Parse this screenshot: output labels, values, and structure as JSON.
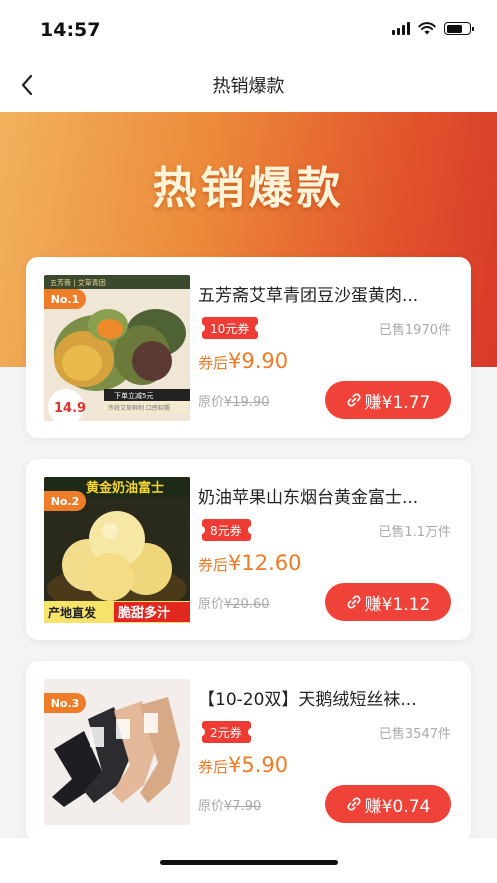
{
  "status_bar": {
    "time": "14:57"
  },
  "nav": {
    "title": "热销爆款"
  },
  "banner": {
    "title": "热销爆款"
  },
  "products": [
    {
      "rank": "No.1",
      "title": "五芳斋艾草青团豆沙蛋黄肉...",
      "coupon": "10元券",
      "sold": "已售1970件",
      "after_label": "券后",
      "after_price": "¥9.90",
      "orig_label": "原价",
      "orig_price": "¥19.90",
      "earn": "赚¥1.77",
      "thumb": {
        "top_text": "五芳斋 | 艾草青团",
        "price_badge": "14.9",
        "banner_text": "下单立减5元",
        "bottom_text": "传统艾草鲜制 口感软糯"
      }
    },
    {
      "rank": "No.2",
      "title": "奶油苹果山东烟台黄金富士...",
      "coupon": "8元券",
      "sold": "已售1.1万件",
      "after_label": "券后",
      "after_price": "¥12.60",
      "orig_label": "原价",
      "orig_price": "¥20.60",
      "earn": "赚¥1.12",
      "thumb": {
        "top_text": "黄金奶油富士",
        "bottom_left": "产地直发",
        "bottom_right": "脆甜多汁"
      }
    },
    {
      "rank": "No.3",
      "title": "【10-20双】天鹅绒短丝袜...",
      "coupon": "2元券",
      "sold": "已售3547件",
      "after_label": "券后",
      "after_price": "¥5.90",
      "orig_label": "原价",
      "orig_price": "¥7.90",
      "earn": "赚¥0.74"
    }
  ],
  "colors": {
    "accent": "#ef4339",
    "price": "#f07a25",
    "rank_tag": "#ee7d2a",
    "banner_start": "#f2b25d",
    "banner_end": "#d8392a"
  },
  "icons": {
    "back": "chevron-left-icon",
    "earn": "link-icon",
    "signal": "cellular-signal-icon",
    "wifi": "wifi-icon",
    "battery": "battery-icon"
  }
}
